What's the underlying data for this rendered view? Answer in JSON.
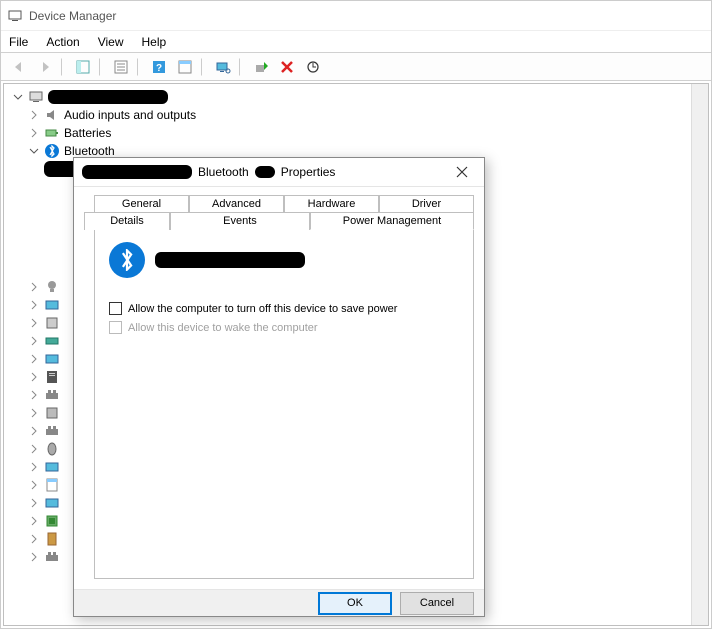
{
  "window": {
    "title": "Device Manager"
  },
  "menubar": {
    "file": "File",
    "action": "Action",
    "view": "View",
    "help": "Help"
  },
  "tree": {
    "root_redacted": true,
    "items": [
      {
        "label": "Audio inputs and outputs",
        "expandable": true,
        "icon": "speaker"
      },
      {
        "label": "Batteries",
        "expandable": true,
        "icon": "battery"
      },
      {
        "label": "Bluetooth",
        "expandable": true,
        "expanded": true,
        "icon": "bluetooth"
      }
    ],
    "remaining_expanders": 16
  },
  "dialog": {
    "title_suffix": "Properties",
    "title_mid": "Bluetooth",
    "tabs_top": [
      "General",
      "Advanced",
      "Hardware",
      "Driver"
    ],
    "tabs_bottom": [
      "Details",
      "Events",
      "Power Management"
    ],
    "active_tab": "Power Management",
    "checkbox1": "Allow the computer to turn off this device to save power",
    "checkbox1_checked": false,
    "checkbox2": "Allow this device to wake the computer",
    "checkbox2_enabled": false,
    "ok": "OK",
    "cancel": "Cancel"
  }
}
